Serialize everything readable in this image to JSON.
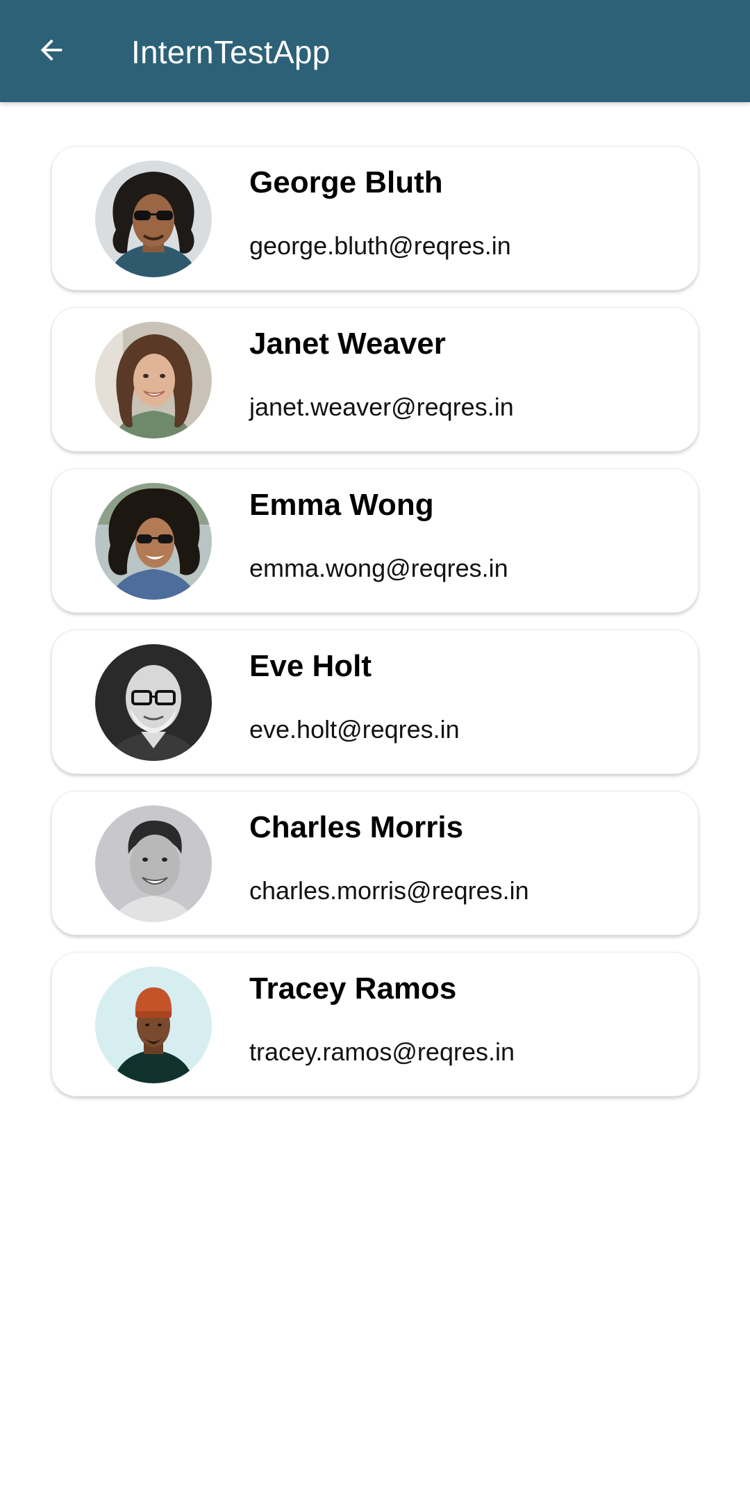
{
  "app_bar": {
    "title": "InternTestApp",
    "back_icon": "arrow-back-icon",
    "background_color": "#2c6178",
    "text_color": "#ffffff"
  },
  "users": [
    {
      "name": "George Bluth",
      "email": "george.bluth@reqres.in",
      "avatar_icon": "avatar-photo"
    },
    {
      "name": "Janet Weaver",
      "email": "janet.weaver@reqres.in",
      "avatar_icon": "avatar-photo"
    },
    {
      "name": "Emma Wong",
      "email": "emma.wong@reqres.in",
      "avatar_icon": "avatar-photo"
    },
    {
      "name": "Eve Holt",
      "email": "eve.holt@reqres.in",
      "avatar_icon": "avatar-photo"
    },
    {
      "name": "Charles Morris",
      "email": "charles.morris@reqres.in",
      "avatar_icon": "avatar-photo"
    },
    {
      "name": "Tracey Ramos",
      "email": "tracey.ramos@reqres.in",
      "avatar_icon": "avatar-photo"
    }
  ]
}
